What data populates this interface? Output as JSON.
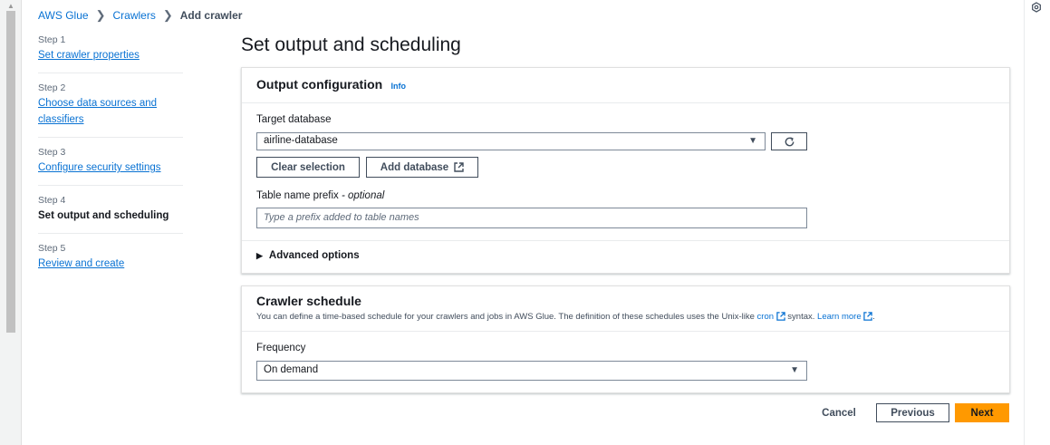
{
  "breadcrumb": {
    "root": "AWS Glue",
    "parent": "Crawlers",
    "current": "Add crawler"
  },
  "steps": [
    {
      "num": "Step 1",
      "label": "Set crawler properties"
    },
    {
      "num": "Step 2",
      "label": "Choose data sources and classifiers"
    },
    {
      "num": "Step 3",
      "label": "Configure security settings"
    },
    {
      "num": "Step 4",
      "label": "Set output and scheduling"
    },
    {
      "num": "Step 5",
      "label": "Review and create"
    }
  ],
  "page_title": "Set output and scheduling",
  "output_config": {
    "title": "Output configuration",
    "info": "Info",
    "target_db_label": "Target database",
    "target_db_value": "airline-database",
    "clear_selection": "Clear selection",
    "add_database": "Add database",
    "prefix_label": "Table name prefix",
    "prefix_optional": " - optional",
    "prefix_placeholder": "Type a prefix added to table names",
    "advanced": "Advanced options"
  },
  "schedule": {
    "title": "Crawler schedule",
    "desc_pre": "You can define a time-based schedule for your crawlers and jobs in AWS Glue. The definition of these schedules uses the Unix-like ",
    "cron": "cron",
    "desc_mid": " syntax. ",
    "learn_more": "Learn more",
    "desc_end": ".",
    "frequency_label": "Frequency",
    "frequency_value": "On demand"
  },
  "footer": {
    "cancel": "Cancel",
    "previous": "Previous",
    "next": "Next"
  },
  "colors": {
    "primary": "#ff9900",
    "link": "#0972d3",
    "text": "#16191f"
  }
}
